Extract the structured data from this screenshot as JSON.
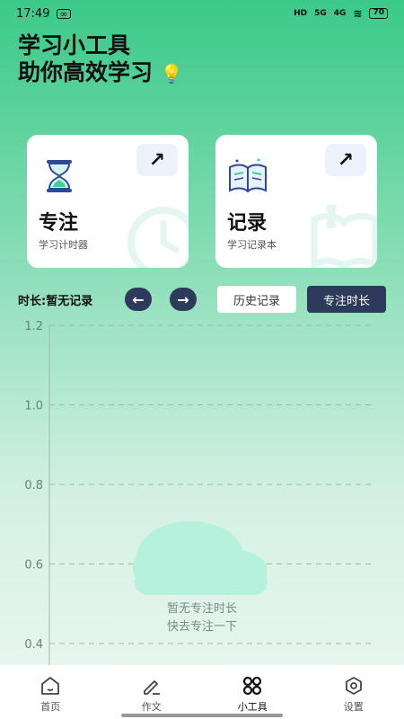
{
  "status_bar": {
    "time": "17:49",
    "network": "5G",
    "network2": "4G",
    "battery": "70"
  },
  "headline": {
    "line1": "学习小工具",
    "line2": "助你高效学习",
    "bulb_icon": "lightbulb-icon"
  },
  "cards": [
    {
      "title": "专注",
      "subtitle": "学习计时器",
      "icon": "hourglass-icon",
      "arrow_icon": "arrow-up-right-icon"
    },
    {
      "title": "记录",
      "subtitle": "学习记录本",
      "icon": "book-icon",
      "arrow_icon": "arrow-up-right-icon"
    }
  ],
  "controls": {
    "duration_label": "时长:暂无记录",
    "prev_icon": "arrow-left-icon",
    "next_icon": "arrow-right-icon",
    "history_label": "历史记录",
    "focus_label": "专注时长"
  },
  "chart_data": {
    "type": "line",
    "series": [],
    "y_ticks": [
      "1.2",
      "1.0",
      "0.8",
      "0.6",
      "0.4"
    ],
    "ylim": [
      0.4,
      1.2
    ],
    "grid": true,
    "empty_message_1": "暂无专注时长",
    "empty_message_2": "快去专注一下"
  },
  "tabs": [
    {
      "label": "首页",
      "icon": "home-icon",
      "active": false
    },
    {
      "label": "作文",
      "icon": "pen-icon",
      "active": false
    },
    {
      "label": "小工具",
      "icon": "tools-icon",
      "active": true
    },
    {
      "label": "设置",
      "icon": "settings-icon",
      "active": false
    }
  ],
  "colors": {
    "accent_dark": "#2e3a5c",
    "green": "#3cc98a",
    "cloud": "#b5f1dc"
  }
}
